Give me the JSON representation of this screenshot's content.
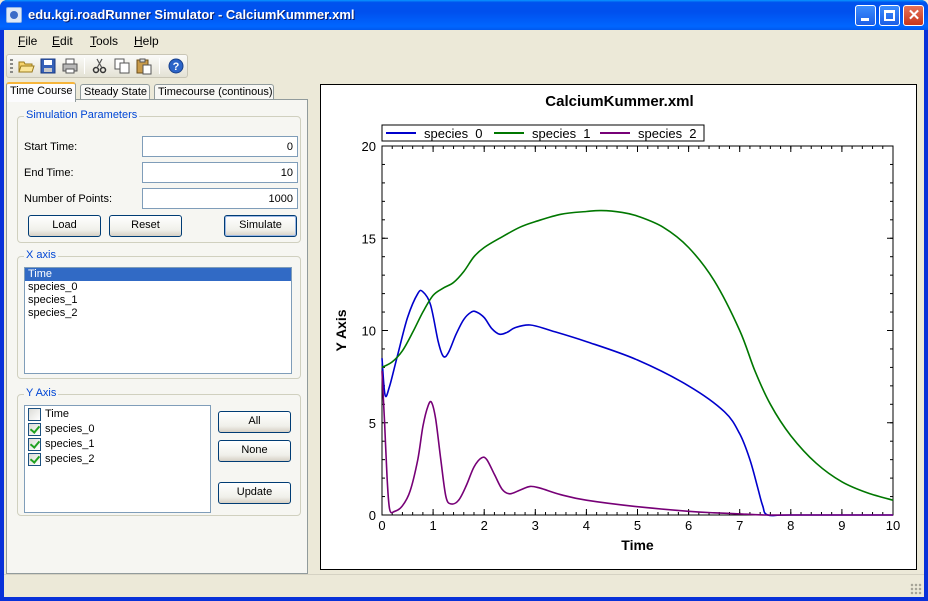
{
  "window": {
    "title": "edu.kgi.roadRunner Simulator - CalciumKummer.xml"
  },
  "menu": {
    "items": [
      "File",
      "Edit",
      "Tools",
      "Help"
    ]
  },
  "toolbar": {
    "icons": [
      "open-folder-icon",
      "save-icon",
      "print-icon",
      "cut-icon",
      "copy-icon",
      "paste-icon",
      "help-icon"
    ]
  },
  "tabs": [
    "Time Course",
    "Steady State",
    "Timecourse (continous)"
  ],
  "simulation": {
    "group_title": "Simulation Parameters",
    "start_time_label": "Start Time:",
    "start_time_value": "0",
    "end_time_label": "End Time:",
    "end_time_value": "10",
    "num_points_label": "Number of Points:",
    "num_points_value": "1000",
    "load_label": "Load",
    "reset_label": "Reset",
    "simulate_label": "Simulate"
  },
  "x_axis": {
    "group_title": "X axis",
    "items": [
      "Time",
      "species_0",
      "species_1",
      "species_2"
    ],
    "selected": "Time"
  },
  "y_axis": {
    "group_title": "Y Axis",
    "items": [
      {
        "label": "Time",
        "checked": false
      },
      {
        "label": "species_0",
        "checked": true
      },
      {
        "label": "species_1",
        "checked": true
      },
      {
        "label": "species_2",
        "checked": true
      }
    ],
    "all_label": "All",
    "none_label": "None",
    "update_label": "Update"
  },
  "chart_data": {
    "type": "line",
    "title": "CalciumKummer.xml",
    "xlabel": "Time",
    "ylabel": "Y Axis",
    "xlim": [
      0,
      10
    ],
    "ylim": [
      0,
      20
    ],
    "xticks": [
      0,
      1,
      2,
      3,
      4,
      5,
      6,
      7,
      8,
      9,
      10
    ],
    "yticks": [
      0,
      5,
      10,
      15,
      20
    ],
    "grid": false,
    "legend_placement": "top",
    "series": [
      {
        "name": "species_0",
        "legend_label": "species  0",
        "color": "#0000cc",
        "x": [
          0,
          0.06,
          0.15,
          0.3,
          0.5,
          0.7,
          0.8,
          0.95,
          1.1,
          1.2,
          1.3,
          1.45,
          1.6,
          1.75,
          1.85,
          2.0,
          2.15,
          2.3,
          2.45,
          2.6,
          2.9,
          3.3,
          4.0,
          5.0,
          6.0,
          6.7,
          7.0,
          7.2,
          7.35,
          7.45,
          7.55,
          8.0,
          10.0
        ],
        "y": [
          8.5,
          6.5,
          7.0,
          8.6,
          10.7,
          12.0,
          12.1,
          11.4,
          9.4,
          8.6,
          8.8,
          9.8,
          10.6,
          11.0,
          11.0,
          10.7,
          10.1,
          9.8,
          9.9,
          10.15,
          10.3,
          10.0,
          9.4,
          8.4,
          7.0,
          5.6,
          4.4,
          3.0,
          1.5,
          0.5,
          0.0,
          0.0,
          0.0
        ]
      },
      {
        "name": "species_1",
        "legend_label": "species  1",
        "color": "#007700",
        "x": [
          0,
          0.2,
          0.4,
          0.6,
          0.8,
          1.0,
          1.2,
          1.4,
          1.6,
          1.8,
          2.0,
          2.3,
          2.7,
          3.0,
          3.5,
          4.0,
          4.3,
          4.7,
          5.0,
          5.5,
          6.0,
          6.5,
          7.0,
          7.3,
          7.6,
          8.0,
          8.5,
          9.0,
          9.5,
          10.0
        ],
        "y": [
          8.0,
          8.3,
          8.9,
          9.9,
          11.0,
          11.9,
          12.3,
          12.6,
          13.2,
          14.0,
          14.5,
          15.0,
          15.6,
          15.9,
          16.3,
          16.45,
          16.5,
          16.4,
          16.2,
          15.6,
          14.5,
          12.7,
          10.0,
          7.8,
          6.0,
          4.3,
          2.8,
          1.8,
          1.2,
          0.8
        ]
      },
      {
        "name": "species_2",
        "legend_label": "species  2",
        "color": "#770077",
        "x": [
          0,
          0.05,
          0.1,
          0.15,
          0.25,
          0.4,
          0.55,
          0.7,
          0.8,
          0.9,
          0.97,
          1.05,
          1.15,
          1.25,
          1.35,
          1.5,
          1.65,
          1.8,
          1.95,
          2.05,
          2.2,
          2.35,
          2.5,
          2.7,
          2.9,
          3.1,
          3.5,
          4.0,
          5.0,
          6.0,
          6.5,
          7.0,
          7.5,
          8.0,
          10.0
        ],
        "y": [
          7.8,
          5.0,
          2.0,
          0.3,
          0.2,
          0.5,
          1.3,
          3.0,
          4.8,
          5.9,
          6.1,
          5.2,
          3.0,
          1.0,
          0.6,
          0.8,
          1.6,
          2.6,
          3.1,
          3.0,
          2.2,
          1.4,
          1.15,
          1.35,
          1.55,
          1.45,
          1.1,
          0.8,
          0.45,
          0.2,
          0.12,
          0.06,
          0.0,
          0.0,
          0.0
        ]
      }
    ]
  }
}
